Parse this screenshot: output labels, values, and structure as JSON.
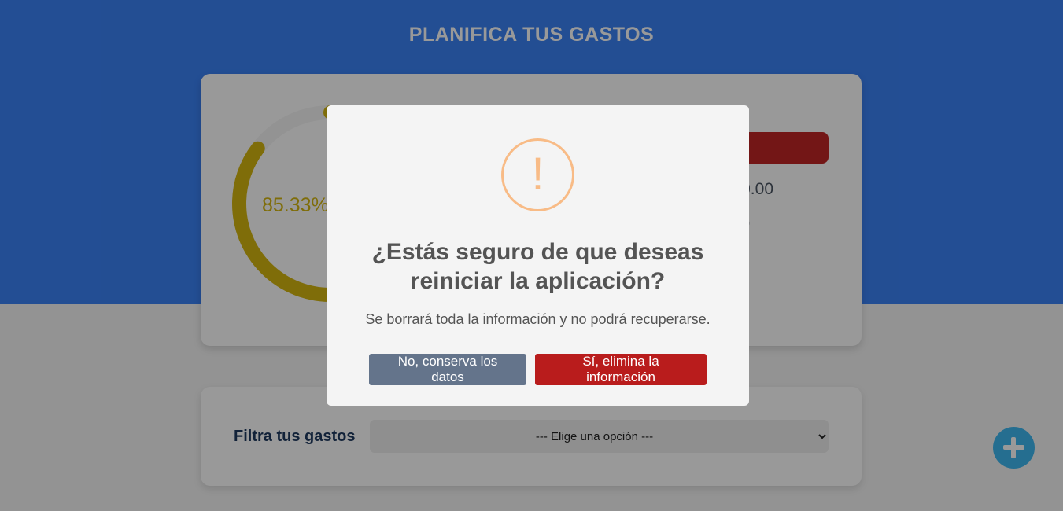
{
  "page": {
    "title": "PLANIFICA TUS GASTOS"
  },
  "budget": {
    "progress_text": "85.33%",
    "progress_fraction": 0.8533,
    "amount_fragment": "0.00",
    "extra_fragment": "0"
  },
  "filter": {
    "label": "Filtra tus gastos",
    "selected_option": "--- Elige una opción ---"
  },
  "dialog": {
    "icon": "!",
    "title": "¿Estás seguro de que deseas reiniciar la aplicación?",
    "text": "Se borrará toda la información y no podrá recuperarse.",
    "cancel_label": "No, conserva los datos",
    "confirm_label": "Sí, elimina la información"
  },
  "colors": {
    "header": "#3b82f6",
    "progress": "#d4b60f",
    "danger": "#b91c1c",
    "cancel": "#64748b",
    "warning": "#f8bb86",
    "fab": "#3fb8f0"
  },
  "icons": {
    "fab": "plus-icon",
    "dialog": "warning-icon",
    "select": "chevron-down-icon"
  }
}
